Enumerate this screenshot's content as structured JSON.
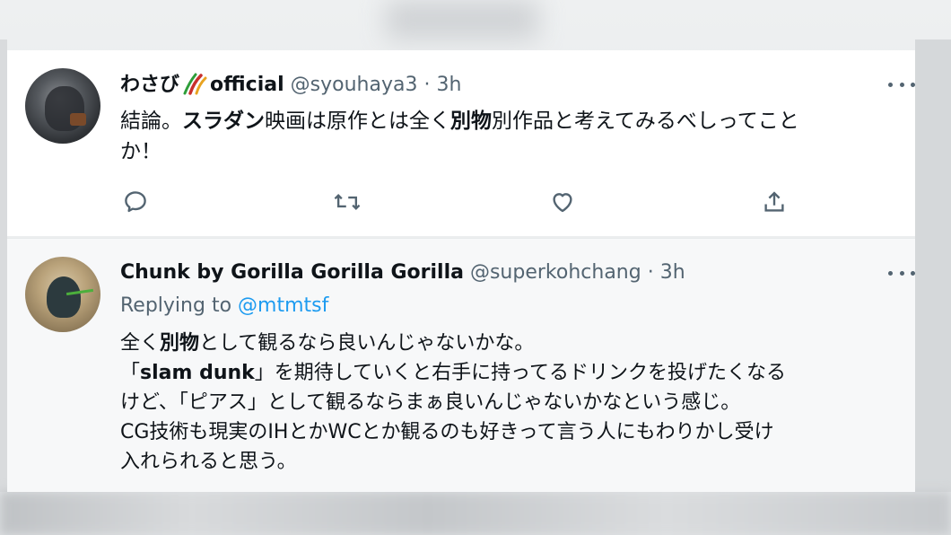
{
  "tweets": [
    {
      "display_name_pre": "わさび",
      "display_name_post": "official",
      "name_icon": "chili-pepper-icon",
      "handle": "@syouhaya3",
      "separator": "·",
      "time": "3h",
      "body": {
        "p1": "結論。",
        "b1": "スラダン",
        "p2": "映画は原作とは全く",
        "b2": "別物",
        "p3": "別作品と考えてみるべしってこと",
        "line2": "か！"
      },
      "actions": [
        "reply-icon",
        "retweet-icon",
        "like-icon",
        "share-icon"
      ]
    },
    {
      "display_name": "Chunk by Gorilla Gorilla Gorilla",
      "handle": "@superkohchang",
      "separator": "·",
      "time": "3h",
      "replying_prefix": "Replying to",
      "replying_to": "@mtmtsf",
      "body": {
        "l1_pre": "全く",
        "l1_bold": "別物",
        "l1_post": "として観るなら良いんじゃないかな。",
        "l2_open": "「",
        "l2_bold": "slam dunk",
        "l2_post": "」を期待していくと右手に持ってるドリンクを投げたくなる",
        "l3": "けど、「ピアス」として観るならまぁ良いんじゃないかなという感じ。",
        "l4": "CG技術も現実のIHとかWCとか観るのも好きって言う人にもわりかし受け",
        "l5": "入れられると思う。"
      }
    }
  ],
  "colors": {
    "link": "#1d9bf0",
    "muted": "#536471",
    "text": "#0f1419"
  }
}
